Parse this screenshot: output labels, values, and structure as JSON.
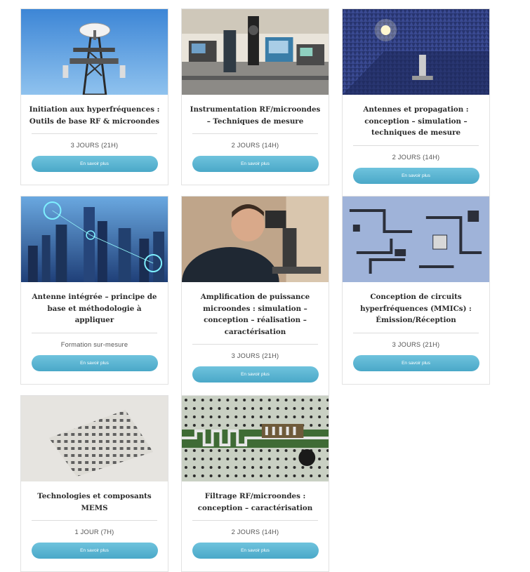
{
  "cards": [
    {
      "title": "Initiation aux hyperfréquences : Outils de base RF & microondes",
      "duration": "3 JOURS (21H)",
      "button": "En savoir plus"
    },
    {
      "title": "Instrumentation RF/microondes – Techniques de mesure",
      "duration": "2 JOURS (14H)",
      "button": "En savoir plus"
    },
    {
      "title": "Antennes et propagation : conception – simulation – techniques de mesure",
      "duration": "2 JOURS (14H)",
      "button": "En savoir plus"
    },
    {
      "title": "Antenne intégrée – principe de base et méthodologie à appliquer",
      "duration": "Formation sur-mesure",
      "button": "En savoir plus"
    },
    {
      "title": "Amplification de puissance microondes : simulation – conception – réalisation – caractérisation",
      "duration": "3 JOURS (21H)",
      "button": "En savoir plus"
    },
    {
      "title": "Conception de circuits hyperfréquences (MMICs) : Émission/Réception",
      "duration": "3 JOURS (21H)",
      "button": "En savoir plus"
    },
    {
      "title": "Technologies et composants MEMS",
      "duration": "1 JOUR (7H)",
      "button": "En savoir plus"
    },
    {
      "title": "Filtrage RF/microondes : conception – caractérisation",
      "duration": "2 JOURS (14H)",
      "button": "En savoir plus"
    }
  ],
  "images": [
    "telecom-tower-image",
    "rf-lab-instrumentation-image",
    "anechoic-chamber-image",
    "smart-city-network-image",
    "engineer-microscope-image",
    "mmic-circuit-image",
    "mems-chip-array-image",
    "rf-filter-pcb-image"
  ],
  "colors": {
    "button": "#56b3d1",
    "title": "#2b2b2b",
    "border": "#e2e2e2"
  }
}
